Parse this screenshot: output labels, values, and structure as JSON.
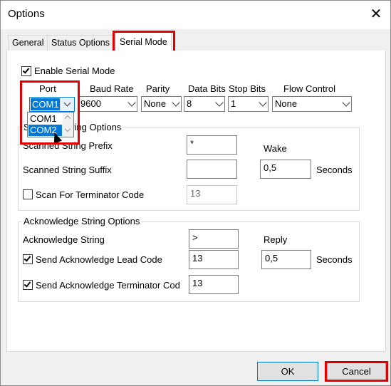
{
  "window": {
    "title": "Options",
    "close_icon": "close-icon"
  },
  "tabs": [
    {
      "label": "General",
      "active": false
    },
    {
      "label": "Status Options",
      "active": false
    },
    {
      "label": "Serial Mode",
      "active": true
    }
  ],
  "serial": {
    "enable_label": "Enable Serial Mode",
    "enable_checked": true,
    "columns": {
      "port": "Port",
      "baud": "Baud Rate",
      "parity": "Parity",
      "data_bits": "Data Bits",
      "stop_bits": "Stop Bits",
      "flow": "Flow Control"
    },
    "values": {
      "port": "COM1",
      "baud": "9600",
      "parity": "None",
      "data_bits": "8",
      "stop_bits": "1",
      "flow": "None"
    },
    "port_options": [
      "COM1",
      "COM2"
    ],
    "port_highlighted_option": "COM2"
  },
  "scanned": {
    "group_title": "Scanned String Options",
    "prefix_label": "Scanned String Prefix",
    "prefix_value": "*",
    "suffix_label": "Scanned String Suffix",
    "suffix_value": "",
    "wake_label": "Wake",
    "wake_value": "0,5",
    "wake_unit": "Seconds",
    "terminator_label": "Scan For Terminator Code",
    "terminator_checked": false,
    "terminator_value": "13"
  },
  "ack": {
    "group_title": "Acknowledge String Options",
    "string_label": "Acknowledge String",
    "string_value": ">",
    "reply_label": "Reply",
    "reply_value": "0,5",
    "reply_unit": "Seconds",
    "lead_label": "Send Acknowledge Lead Code",
    "lead_checked": true,
    "lead_value": "13",
    "term_label": "Send Acknowledge Terminator Cod",
    "term_checked": true,
    "term_value": "13"
  },
  "buttons": {
    "ok": "OK",
    "cancel": "Cancel"
  },
  "colors": {
    "highlight_red": "#e00000",
    "selection_blue": "#0078d7"
  }
}
